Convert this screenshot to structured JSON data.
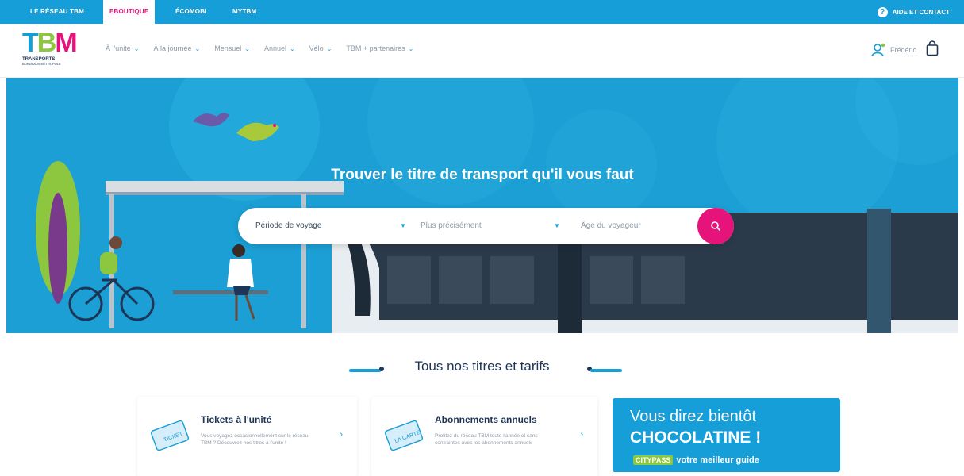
{
  "topbar": {
    "tabs": [
      "LE RÉSEAU TBM",
      "EBOUTIQUE",
      "ÉCOMOBI",
      "MYTBM"
    ],
    "help_label": "AIDE ET CONTACT"
  },
  "logo": {
    "letters": [
      "T",
      "B",
      "M"
    ],
    "sub": "TRANSPORTS",
    "sub2": "BORDEAUX MÉTROPOLE"
  },
  "nav": [
    "À l'unité",
    "À la journée",
    "Mensuel",
    "Annuel",
    "Vélo",
    "TBM + partenaires"
  ],
  "user": {
    "name": "Frédéric"
  },
  "hero": {
    "title": "Trouver le titre de transport qu'il vous faut",
    "search": {
      "field1": "Période de voyage",
      "field2": "Plus précisément",
      "field3": "Âge du voyageur"
    }
  },
  "section": {
    "title": "Tous nos titres et tarifs"
  },
  "cards": [
    {
      "title": "Tickets à l'unité",
      "desc": "Vous voyagez occasionnellement sur le réseau TBM ? Découvrez nos titres à l'unité !"
    },
    {
      "title": "Abonnements annuels",
      "desc": "Profitez du réseau TBM toute l'année et sans contraintes avec les abonnements annuels"
    }
  ],
  "promo": {
    "line1": "Vous direz bientôt",
    "line2": "CHOCOLATINE !",
    "badge": "CITYPASS",
    "line3": "votre meilleur guide"
  },
  "colors": {
    "brand_blue": "#159ed8",
    "brand_pink": "#e6147a",
    "brand_green": "#8dc63f",
    "navy": "#1d3557"
  }
}
